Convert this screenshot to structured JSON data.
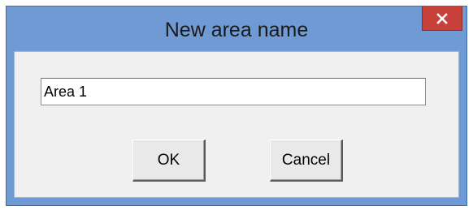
{
  "dialog": {
    "title": "New area name",
    "close_icon": "close-x-icon",
    "input": {
      "value": "Area 1"
    },
    "ok_label": "OK",
    "cancel_label": "Cancel"
  },
  "colors": {
    "frame": "#6f9ad3",
    "close_button": "#c8403a",
    "client_background": "#f0f0f0"
  }
}
